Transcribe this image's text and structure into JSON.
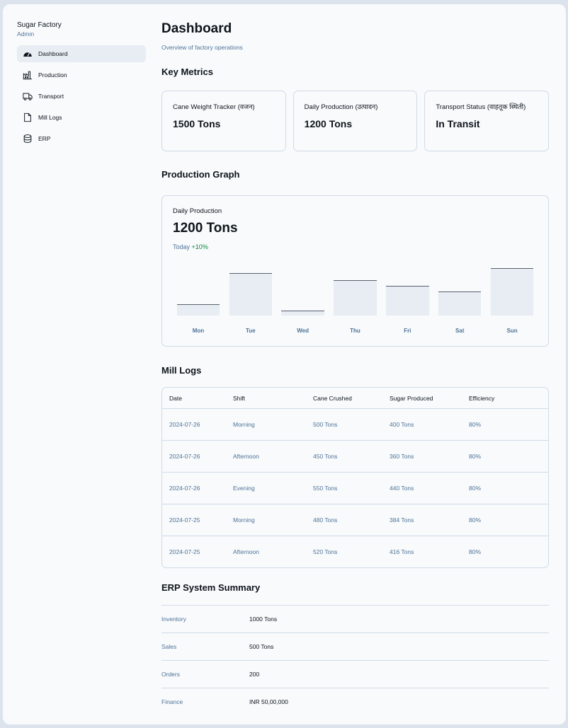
{
  "sidebar": {
    "brand": "Sugar Factory",
    "role": "Admin",
    "items": [
      {
        "label": "Dashboard",
        "icon": "gauge-icon",
        "active": true
      },
      {
        "label": "Production",
        "icon": "factory-icon"
      },
      {
        "label": "Transport",
        "icon": "truck-icon"
      },
      {
        "label": "Mill Logs",
        "icon": "file-icon"
      },
      {
        "label": "ERP",
        "icon": "database-icon"
      }
    ]
  },
  "header": {
    "title": "Dashboard",
    "subtitle": "Overview of factory operations"
  },
  "metrics": {
    "title": "Key Metrics",
    "cards": [
      {
        "label": "Cane Weight Tracker (वजन)",
        "value": "1500 Tons"
      },
      {
        "label": "Daily Production (उत्पादन)",
        "value": "1200 Tons"
      },
      {
        "label": "Transport Status (वाहतूक स्थिती)",
        "value": "In Transit"
      }
    ]
  },
  "graph": {
    "section_title": "Production Graph",
    "label": "Daily Production",
    "value": "1200 Tons",
    "period": "Today",
    "change": "+10%",
    "colors": {
      "bar": "#e7edf3",
      "bar_top": "#57606a",
      "positive": "#078838"
    }
  },
  "chart_data": {
    "type": "bar",
    "categories": [
      "Mon",
      "Tue",
      "Wed",
      "Thu",
      "Fri",
      "Sat",
      "Sun"
    ],
    "values": [
      22,
      80,
      10,
      67,
      56,
      45,
      90
    ],
    "ylim": [
      0,
      100
    ],
    "grid": false
  },
  "mill_logs": {
    "title": "Mill Logs",
    "columns": [
      "Date",
      "Shift",
      "Cane Crushed",
      "Sugar Produced",
      "Efficiency"
    ],
    "rows": [
      [
        "2024-07-26",
        "Morning",
        "500 Tons",
        "400 Tons",
        "80%"
      ],
      [
        "2024-07-26",
        "Afternoon",
        "450 Tons",
        "360 Tons",
        "80%"
      ],
      [
        "2024-07-26",
        "Evening",
        "550 Tons",
        "440 Tons",
        "80%"
      ],
      [
        "2024-07-25",
        "Morning",
        "480 Tons",
        "384 Tons",
        "80%"
      ],
      [
        "2024-07-25",
        "Afternoon",
        "520 Tons",
        "416 Tons",
        "80%"
      ]
    ]
  },
  "erp": {
    "title": "ERP System Summary",
    "rows": [
      {
        "key": "Inventory",
        "value": "1000 Tons"
      },
      {
        "key": "Sales",
        "value": "500 Tons"
      },
      {
        "key": "Orders",
        "value": "200"
      },
      {
        "key": "Finance",
        "value": "INR 50,00,000"
      }
    ]
  }
}
